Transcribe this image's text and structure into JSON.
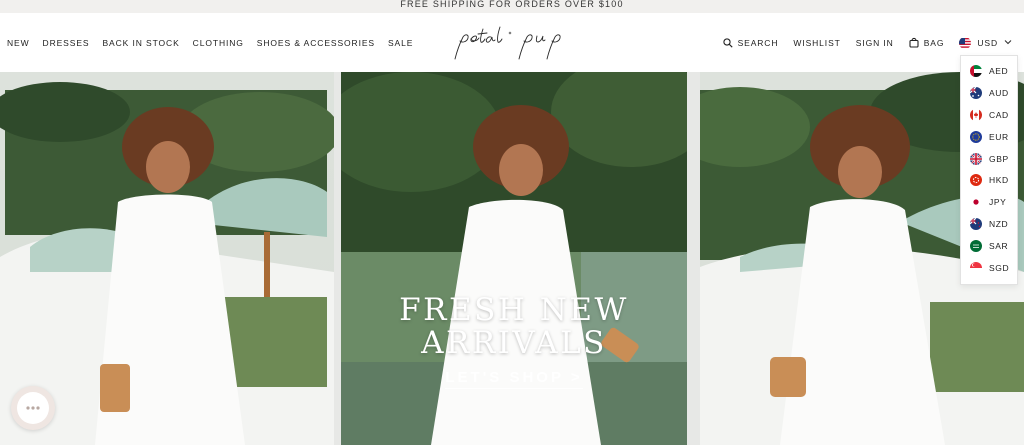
{
  "promo": {
    "text": "FREE SHIPPING FOR ORDERS OVER $100"
  },
  "nav": {
    "left": [
      "NEW",
      "DRESSES",
      "BACK IN STOCK",
      "CLOTHING",
      "SHOES & ACCESSORIES",
      "SALE"
    ],
    "logo": "petal & pup",
    "search": "SEARCH",
    "wishlist": "WISHLIST",
    "sign_in": "SIGN IN",
    "bag": "BAG",
    "currency": "USD"
  },
  "currency_menu": {
    "items": [
      {
        "code": "AED",
        "icon": "uae-flag-icon"
      },
      {
        "code": "AUD",
        "icon": "australia-flag-icon"
      },
      {
        "code": "CAD",
        "icon": "canada-flag-icon"
      },
      {
        "code": "EUR",
        "icon": "eu-flag-icon"
      },
      {
        "code": "GBP",
        "icon": "uk-flag-icon"
      },
      {
        "code": "HKD",
        "icon": "hong-kong-flag-icon"
      },
      {
        "code": "JPY",
        "icon": "japan-flag-icon"
      },
      {
        "code": "NZD",
        "icon": "new-zealand-flag-icon"
      },
      {
        "code": "SAR",
        "icon": "saudi-arabia-flag-icon"
      },
      {
        "code": "SGD",
        "icon": "singapore-flag-icon"
      }
    ]
  },
  "hero": {
    "title": "FRESH NEW\nARRIVALS",
    "cta": "LET'S SHOP >"
  },
  "colors": {
    "accent": "#ffffff",
    "promo_bg": "#f1f0ee",
    "chat_ring": "#efe6e2"
  }
}
